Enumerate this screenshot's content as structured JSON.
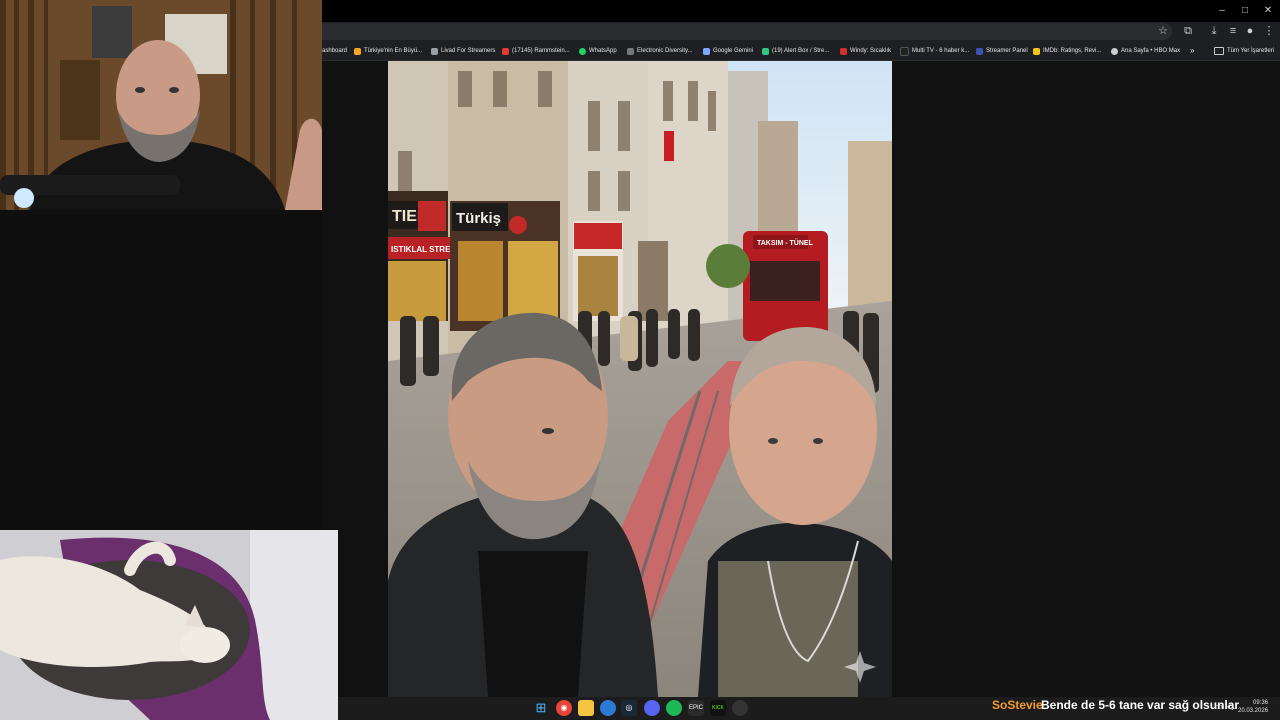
{
  "window_controls": {
    "minimize": "–",
    "maximize": "□",
    "close": "✕"
  },
  "toolbar_icons": [
    "star-icon",
    "extensions-icon",
    "download-icon",
    "cast-icon",
    "profile-icon",
    "menu-icon"
  ],
  "bookmarks": [
    {
      "label": "ashboard",
      "color": "#8ab4f8"
    },
    {
      "label": "Türkiye'nin En Büyü...",
      "color": "#f5a623"
    },
    {
      "label": "Livad For Streamers",
      "color": "#9aa0a6"
    },
    {
      "label": "(17145) Rammstein...",
      "color": "#e53935"
    },
    {
      "label": "WhatsApp",
      "color": "#25d366"
    },
    {
      "label": "Electronic Diversity...",
      "color": "#777777"
    },
    {
      "label": "Google Gemini",
      "color": "#7aa7ff"
    },
    {
      "label": "(19) Alert Box / Stre...",
      "color": "#33c481"
    },
    {
      "label": "Windy: Sıcaklık",
      "color": "#d32f2f"
    },
    {
      "label": "Multi TV - 6 haber k...",
      "color": "#222222"
    },
    {
      "label": "Streamer Panel",
      "color": "#3f51b5"
    },
    {
      "label": "IMDb: Ratings, Revi...",
      "color": "#f5c518"
    },
    {
      "label": "Ana Sayfa • HBO Max",
      "color": "#cccccc"
    }
  ],
  "bookmarks_overflow": "»",
  "all_bookmarks": "Tüm Yer İşaretleri",
  "photo_signs": {
    "tiehsign": "TIEH",
    "turkiyesign": "Türkiş",
    "istiklalsign": "ISTIKLAL STREET",
    "tramsign": "TAKSIM - TÜNEL"
  },
  "taskbar_icons": [
    "windows-icon",
    "chrome-icon",
    "files-icon",
    "edge-icon",
    "steam-icon",
    "discord-icon",
    "spotify-icon",
    "epic-icon",
    "kick-icon",
    "obs-icon"
  ],
  "chat": {
    "user": "SoStevie",
    "message": "Bende de 5-6 tane var sağ olsunlar"
  },
  "clock": {
    "time": "09:36",
    "date": "20.03.2026"
  }
}
